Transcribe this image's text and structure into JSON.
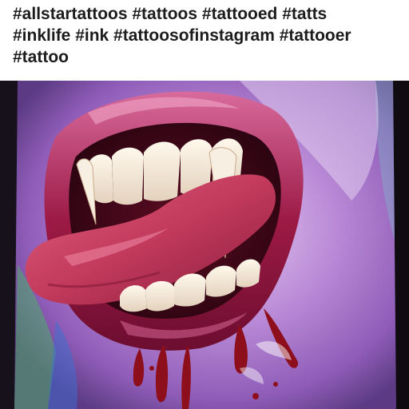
{
  "post": {
    "caption_lines": [
      "#allstartattoos #tattoos #tattooed #tatts",
      "#inklife #ink #tattoosofinstagram #tattooer",
      "#tattoo"
    ]
  },
  "photo": {
    "subject": "color tattoo of an open mouth with vampire fangs, tongue out, dripping blood",
    "colors": {
      "background": "#16111a",
      "skin_purple": "#b98ad6",
      "lip_red": "#9c1a45",
      "tongue": "#c23a5c",
      "teeth": "#f1e7d6",
      "blood": "#8e0f1c"
    }
  }
}
